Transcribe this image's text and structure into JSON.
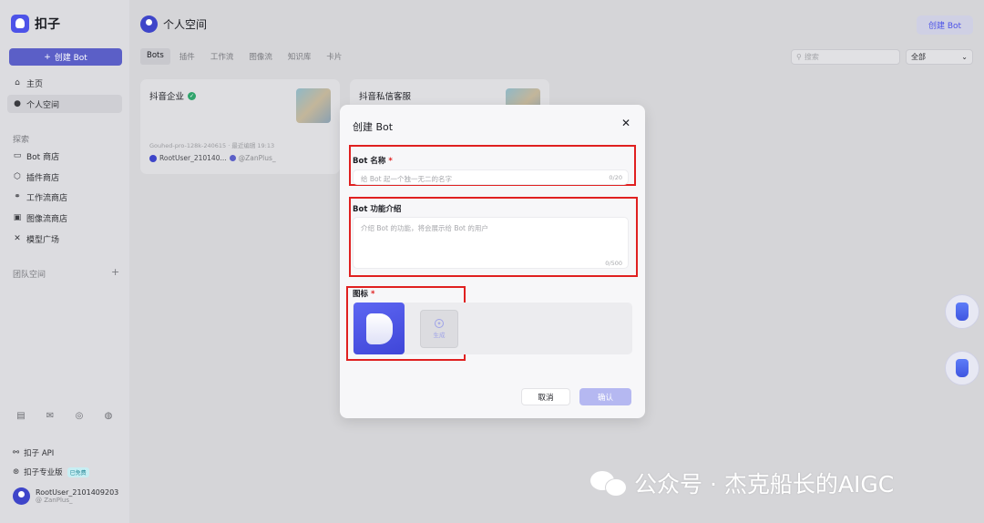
{
  "app": {
    "name": "扣子"
  },
  "sidebar": {
    "create_label": "创建 Bot",
    "items": [
      {
        "label": "主页",
        "icon": "home-icon"
      },
      {
        "label": "个人空间",
        "icon": "user-icon"
      }
    ],
    "explore_label": "探索",
    "explore_items": [
      {
        "label": "Bot 商店",
        "icon": "store-icon"
      },
      {
        "label": "插件商店",
        "icon": "plugin-icon"
      },
      {
        "label": "工作流商店",
        "icon": "workflow-icon"
      },
      {
        "label": "图像流商店",
        "icon": "image-icon"
      },
      {
        "label": "模型广场",
        "icon": "model-icon"
      }
    ],
    "team_label": "团队空间",
    "api_label": "扣子 API",
    "pro_label": "扣子专业版",
    "pro_badge": "已免费",
    "user_name": "RootUser_2101409203",
    "user_sub": "@ ZanPlus_"
  },
  "header": {
    "title": "个人空间",
    "create_label": "创建 Bot",
    "tabs": [
      "Bots",
      "插件",
      "工作流",
      "图像流",
      "知识库",
      "卡片"
    ],
    "search_placeholder": "搜索",
    "filter_value": "全部"
  },
  "cards": [
    {
      "title": "抖音企业",
      "meta": "Gouhed-pro-128k-240615 · 最近编辑 19:13",
      "author": "RootUser_210140...",
      "author_sub": "@ZanPlus_"
    },
    {
      "title": "抖音私信客服"
    }
  ],
  "modal": {
    "title": "创建 Bot",
    "name_label": "Bot 名称",
    "name_placeholder": "给 Bot 起一个独一无二的名字",
    "name_counter": "0/20",
    "desc_label": "Bot 功能介绍",
    "desc_placeholder": "介绍 Bot 的功能，将会展示给 Bot 的用户",
    "desc_counter": "0/500",
    "icon_label": "图标",
    "generate_label": "生成",
    "cancel_label": "取消",
    "confirm_label": "确认",
    "required_mark": "*"
  },
  "watermark": "公众号 · 杰克船长的AIGC",
  "colors": {
    "brand": "#4d53e8",
    "highlight_box": "#e02020",
    "confirm_disabled": "#b5b8f1"
  }
}
